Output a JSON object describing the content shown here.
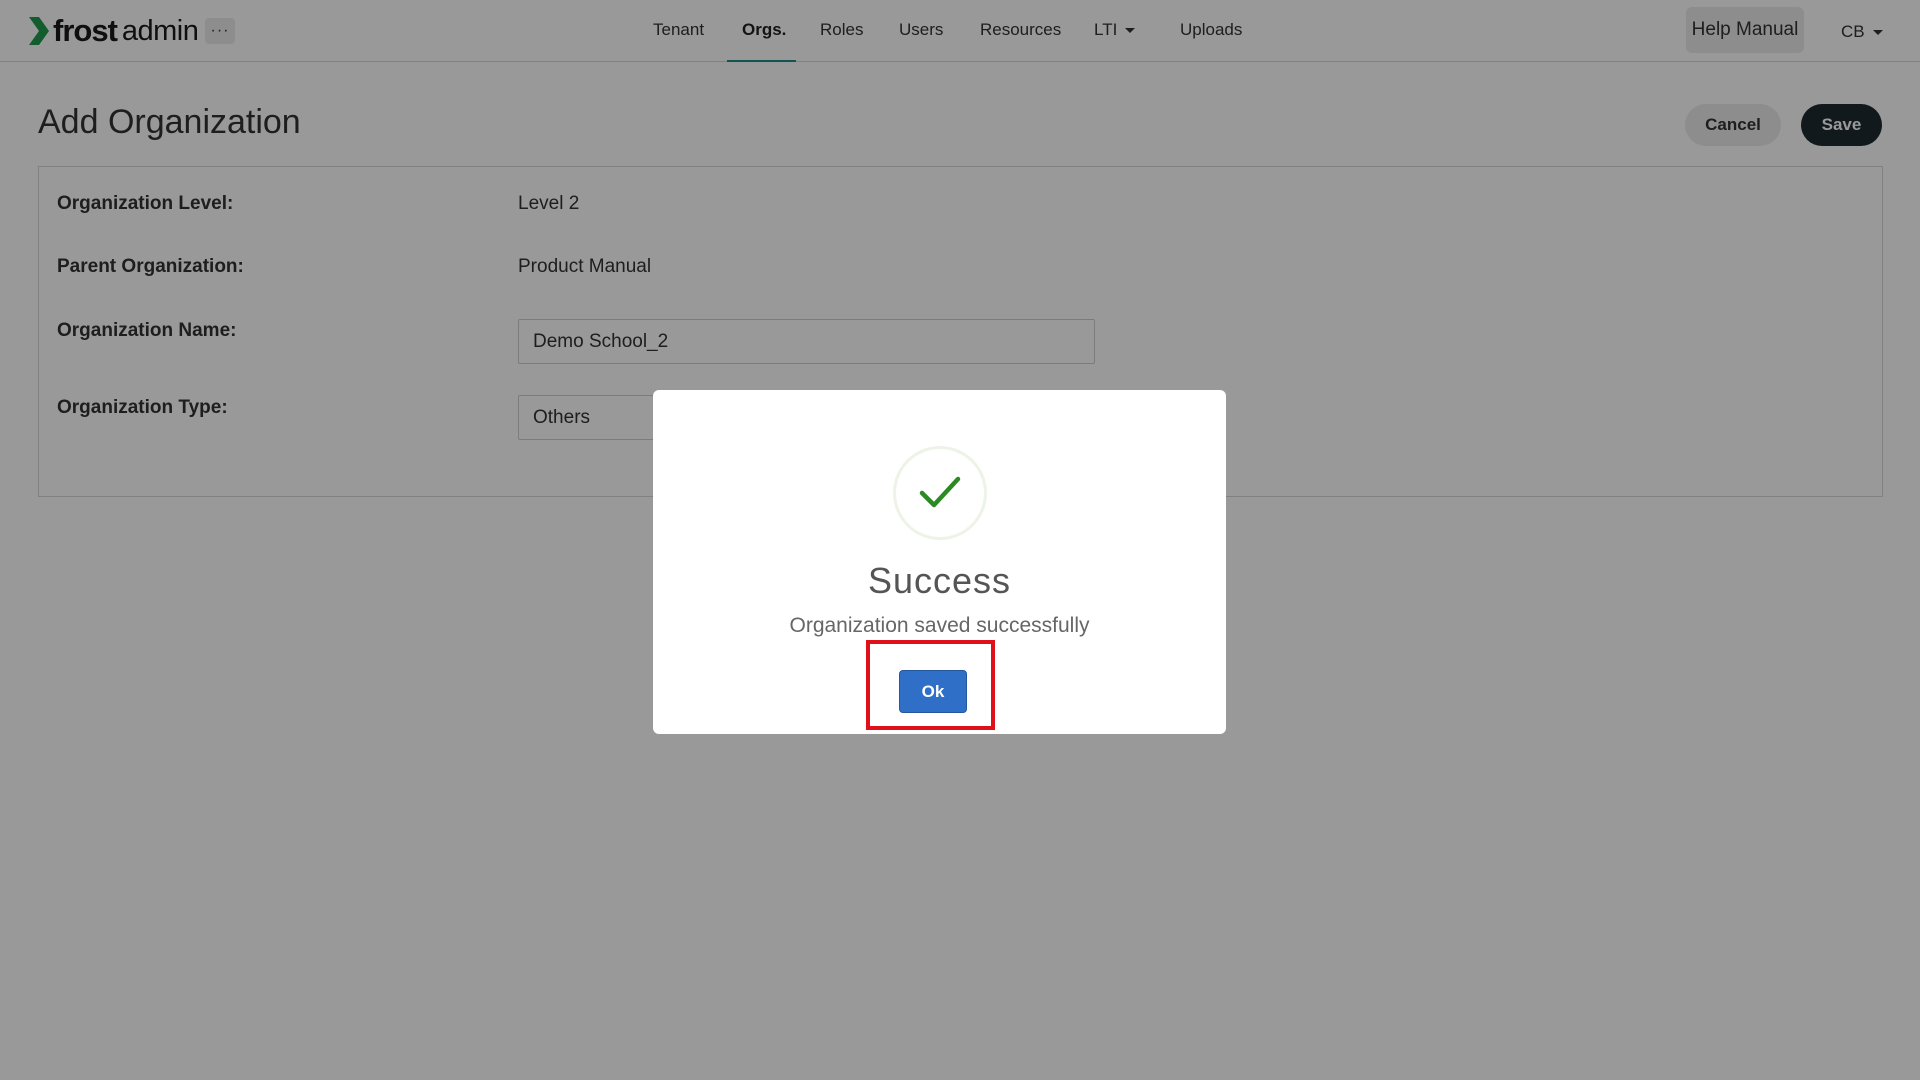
{
  "header": {
    "logo_frost": "frost",
    "logo_admin": "admin",
    "more_label": "···",
    "nav": [
      {
        "label": "Tenant"
      },
      {
        "label": "Orgs."
      },
      {
        "label": "Roles"
      },
      {
        "label": "Users"
      },
      {
        "label": "Resources"
      },
      {
        "label": "LTI"
      },
      {
        "label": "Uploads"
      }
    ],
    "active_nav": "Orgs.",
    "help_label": "Help Manual",
    "user_initials": "CB"
  },
  "page": {
    "title": "Add Organization",
    "cancel_label": "Cancel",
    "save_label": "Save"
  },
  "form": {
    "level_label": "Organization Level:",
    "level_value": "Level 2",
    "parent_label": "Parent Organization:",
    "parent_value": "Product Manual",
    "name_label": "Organization Name:",
    "name_value": "Demo School_2",
    "type_label": "Organization Type:",
    "type_value": "Others"
  },
  "modal": {
    "title": "Success",
    "message": "Organization saved successfully",
    "ok_label": "Ok"
  },
  "colors": {
    "brand_green": "#1f9a4e",
    "nav_underline": "#1f8a8a",
    "save_button": "#1f2a30",
    "ok_button": "#2f6fc7",
    "check": "#2b8a24",
    "highlight": "#e0101a"
  },
  "icons": {
    "logo": "chevron-right-icon",
    "success": "checkmark-icon",
    "dropdown": "caret-down-icon"
  }
}
